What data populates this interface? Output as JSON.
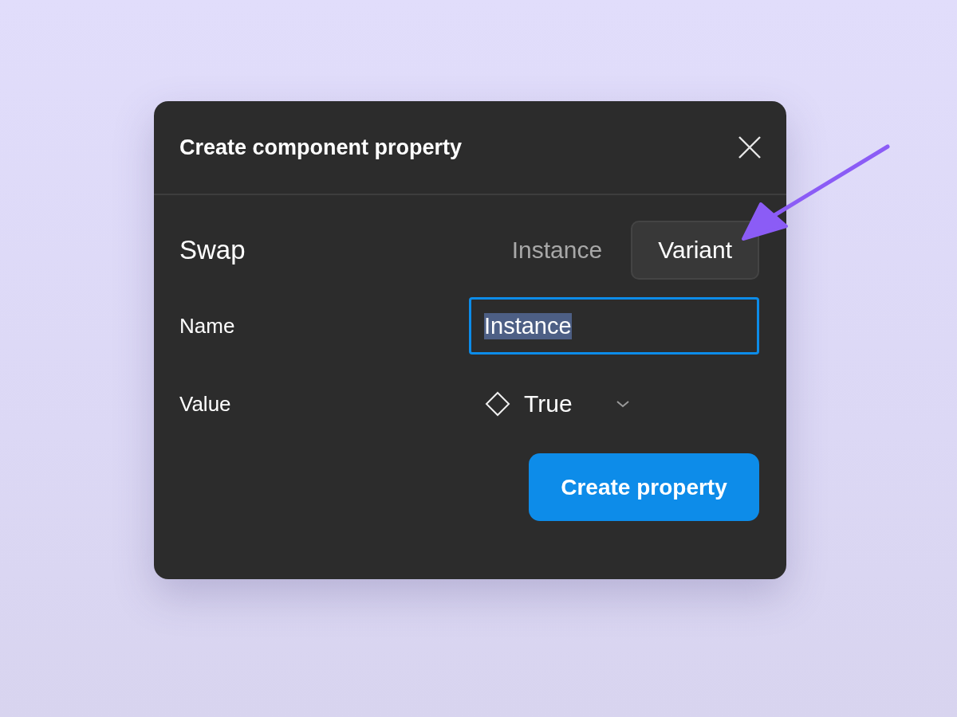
{
  "dialog": {
    "title": "Create component property",
    "type_row": {
      "label": "Swap",
      "options": [
        {
          "label": "Instance",
          "selected": false
        },
        {
          "label": "Variant",
          "selected": true
        }
      ]
    },
    "name_row": {
      "label": "Name",
      "value": "Instance",
      "focused": true,
      "text_selected": true
    },
    "value_row": {
      "label": "Value",
      "value": "True"
    },
    "primary_button": "Create property"
  }
}
